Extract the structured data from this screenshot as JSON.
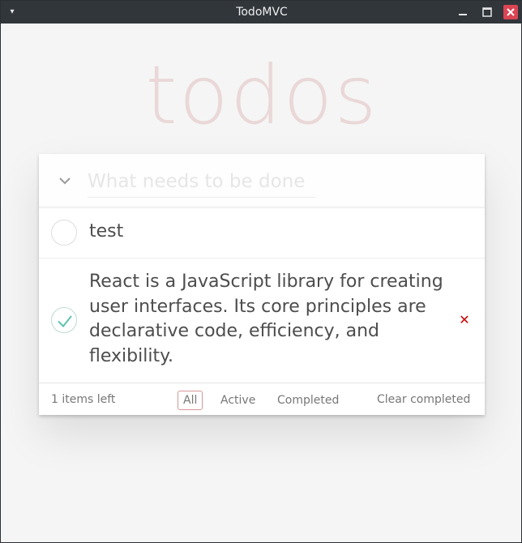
{
  "window": {
    "title": "TodoMVC",
    "menu_icon": "chevron-down-icon",
    "min_icon": "minimize-icon",
    "max_icon": "maximize-icon",
    "close_icon": "close-icon",
    "close_color": "#da4453"
  },
  "app": {
    "heading": "todos",
    "heading_color": "#af2f2f",
    "new_todo_placeholder": "What needs to be done",
    "toggle_all_icon": "chevron-down-icon"
  },
  "todos": [
    {
      "label": "test",
      "completed": false
    },
    {
      "label": "React is a JavaScript library for creating user interfaces. Its core principles are declarative code, efficiency, and flexibility.",
      "completed": true
    }
  ],
  "footer": {
    "count_text": "1 items left",
    "filters": [
      {
        "label": "All",
        "selected": true
      },
      {
        "label": "Active",
        "selected": false
      },
      {
        "label": "Completed",
        "selected": false
      }
    ],
    "clear_label": "Clear completed"
  },
  "colors": {
    "check_color": "#5dc2af",
    "destroy_color": "#cc0000"
  }
}
